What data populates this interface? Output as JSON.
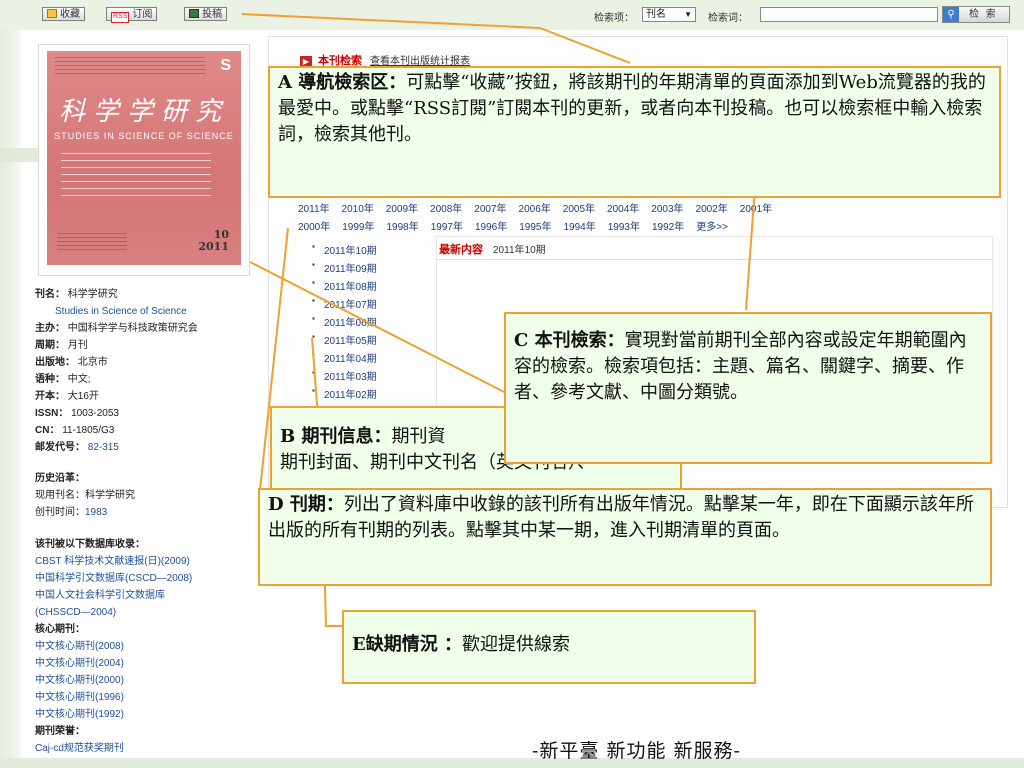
{
  "toolbar": {
    "favorite_label": "收藏",
    "rss_label": "订阅",
    "submit_label": "投稿",
    "search_field_label": "检索项：",
    "search_field_value": "刊名",
    "search_term_label": "检索词：",
    "search_term_value": "",
    "search_button_label": "检 索",
    "rss_badge": "RSS"
  },
  "cover": {
    "title": "科学学研究",
    "subtitle": "STUDIES IN SCIENCE OF SCIENCE",
    "issue_no": "10",
    "year": "2011",
    "logo": "S"
  },
  "journal_info": [
    {
      "label": "刊名：",
      "value": "科学学研究"
    },
    {
      "label": "",
      "value": "Studies in Science of Science"
    },
    {
      "label": "主办：",
      "value": "中国科学学与科技政策研究会"
    },
    {
      "label": "周期：",
      "value": "月刊"
    },
    {
      "label": "出版地：",
      "value": "北京市"
    },
    {
      "label": "语种：",
      "value": "中文;"
    },
    {
      "label": "开本：",
      "value": "大16开"
    },
    {
      "label": "ISSN：",
      "value": "1003-2053"
    },
    {
      "label": "CN：",
      "value": "11-1805/G3"
    },
    {
      "label": "邮发代号：",
      "value": "82-315"
    }
  ],
  "history": {
    "title": "历史沿革：",
    "current_name": "现用刊名：科学学研究",
    "founded_label": "创刊时间：",
    "founded_value": "1983"
  },
  "indexed": {
    "title": "该刊被以下数据库收录：",
    "items": [
      "CBST 科学技术文献速报(日)(2009)",
      "中国科学引文数据库(CSCD—2008)",
      "中国人文社会科学引文数据库",
      "(CHSSCD—2004)"
    ],
    "core_title": "核心期刊：",
    "core_items": [
      "中文核心期刊(2008)",
      "中文核心期刊(2004)",
      "中文核心期刊(2000)",
      "中文核心期刊(1996)",
      "中文核心期刊(1992)"
    ],
    "honor_title": "期刊荣誉：",
    "honor_items": [
      "Caj-cd规范获奖期刊"
    ]
  },
  "main": {
    "section_title": "本刊检索",
    "section_link": "查看本刊出版统计报表",
    "years_row1": [
      "2011年",
      "2010年",
      "2009年",
      "2008年",
      "2007年",
      "2006年",
      "2005年",
      "2004年",
      "2003年",
      "2002年",
      "2001年"
    ],
    "years_row2": [
      "2000年",
      "1999年",
      "1998年",
      "1997年",
      "1996年",
      "1995年",
      "1994年",
      "1993年",
      "1992年",
      "更多>>"
    ],
    "issues": [
      "2011年10期",
      "2011年09期",
      "2011年08期",
      "2011年07期",
      "2011年06期",
      "2011年05期",
      "2011年04期",
      "2011年03期",
      "2011年02期"
    ],
    "latest_title": "最新内容",
    "latest_issue": "2011年10期"
  },
  "callouts": {
    "a_title": "A 導航檢索区：",
    "a_text": "可點擊“收藏”按鈕，將該期刊的年期清單的頁面添加到Web流覽器的我的最愛中。或點擊“RSS訂閱”訂閱本刊的更新，或者向本刊投稿。也可以檢索框中輸入檢索詞，檢索其他刊。",
    "b_title": "B 期刊信息：",
    "b_text": "期刊資",
    "b_line2": "期刊封面、期刊中文刊名（英文刊名）、",
    "c_title": "C 本刊檢索：",
    "c_text": "實現對當前期刊全部內容或設定年期範圍內容的檢索。檢索項包括：主題、篇名、關鍵字、摘要、作者、參考文獻、中圖分類號。",
    "d_title": "D 刊期：",
    "d_text": "列出了資料庫中收錄的該刊所有出版年情況。點擊某一年，即在下面顯示該年所出版的所有刊期的列表。點擊其中某一期，進入刊期清單的頁面。",
    "e_title": "E缺期情況 ：",
    "e_text": "歡迎提供線索"
  },
  "footer": "-新平臺 新功能 新服務-",
  "colors": {
    "callout_border": "#f0a030",
    "callout_bg": "#efffe9",
    "accent_red": "#c00"
  }
}
